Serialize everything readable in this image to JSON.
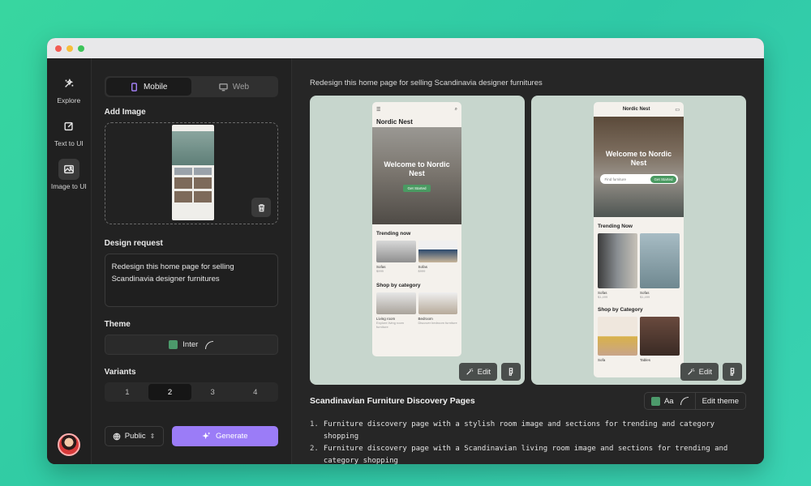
{
  "rail": [
    {
      "label": "Explore",
      "icon": "sparkles-icon"
    },
    {
      "label": "Text to UI",
      "icon": "edit-icon"
    },
    {
      "label": "Image to UI",
      "icon": "image-icon"
    }
  ],
  "panel": {
    "mode_options": [
      "Mobile",
      "Web"
    ],
    "add_image_label": "Add Image",
    "design_request_label": "Design request",
    "design_request_value": "Redesign this home page for selling Scandinavia designer furnitures",
    "theme_label": "Theme",
    "theme_value": "Inter",
    "variants_label": "Variants",
    "variants": [
      "1",
      "2",
      "3",
      "4"
    ],
    "variant_selected": "2",
    "visibility": "Public",
    "generate_label": "Generate"
  },
  "main": {
    "request_text": "Redesign this home page for selling Scandinavia designer furnitures",
    "card1": {
      "brand": "Nordic Nest",
      "hero_title": "Welcome to Nordic Nest",
      "cta": "Get Started",
      "trending": "Trending now",
      "items": [
        {
          "name": "Sofas",
          "price": "$999"
        },
        {
          "name": "Sofas",
          "price": "$999"
        }
      ],
      "shop": "Shop by category",
      "categories": [
        {
          "name": "Living room",
          "sub": "Explore living room furniture"
        },
        {
          "name": "Bedroom",
          "sub": "Discover bedroom furniture"
        }
      ]
    },
    "card2": {
      "brand": "Nordic Nest",
      "hero_title": "Welcome to Nordic Nest",
      "search_placeholder": "Find furniture",
      "cta": "Get Started",
      "trending": "Trending Now",
      "items": [
        {
          "name": "Sofas",
          "price": "$1,499"
        },
        {
          "name": "Sofas",
          "price": "$1,499"
        }
      ],
      "shop": "Shop by Category",
      "categories": [
        {
          "name": "Sofa"
        },
        {
          "name": "Tables"
        }
      ]
    },
    "edit_label": "Edit",
    "result_title": "Scandinavian Furniture Discovery Pages",
    "theme_button_label": "Aa",
    "edit_theme_label": "Edit theme",
    "descriptions": [
      {
        "num": "1.",
        "text": "Furniture discovery page with a stylish room image and sections for trending and category shopping"
      },
      {
        "num": "2.",
        "text": "Furniture discovery page with a Scandinavian living room image and sections for trending and category shopping"
      }
    ]
  }
}
